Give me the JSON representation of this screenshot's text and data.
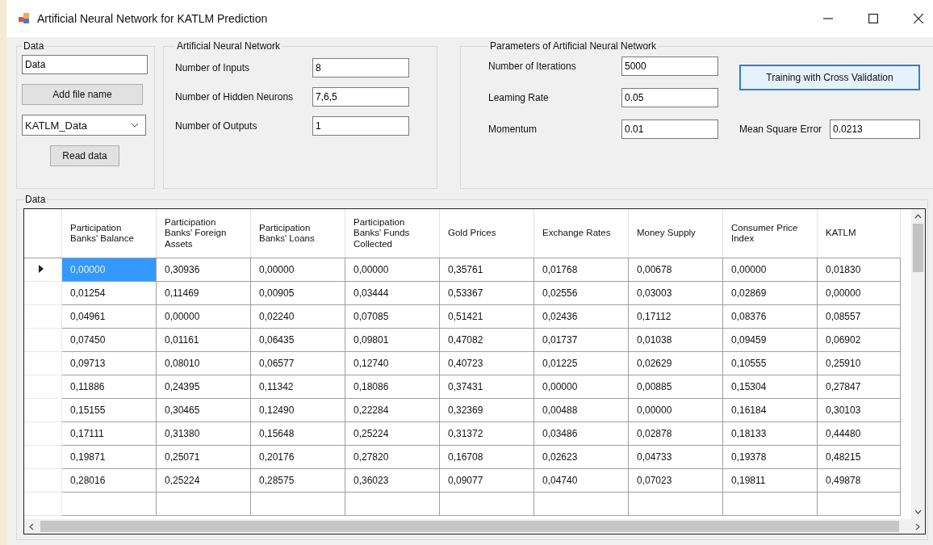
{
  "window": {
    "title": "Artificial Neural Network for KATLM Prediction"
  },
  "data_group": {
    "title": "Data",
    "file_field": {
      "value": "Data"
    },
    "add_button": "Add file name",
    "dataset_select": {
      "value": "KATLM_Data"
    },
    "read_button": "Read data"
  },
  "ann_group": {
    "title": "Artificial Neural Network",
    "fields": [
      {
        "label": "Number of Inputs",
        "value": "8"
      },
      {
        "label": "Number of Hidden Neurons",
        "value": "7,6,5"
      },
      {
        "label": "Number of Outputs",
        "value": "1"
      }
    ]
  },
  "params_group": {
    "title": "Parameters of Artificial Neural Network",
    "fields": [
      {
        "label": "Number of Iterations",
        "value": "5000"
      },
      {
        "label": "Leaming Rate",
        "value": "0.05"
      },
      {
        "label": "Momentum",
        "value": "0.01"
      }
    ],
    "train_button": {
      "label": "Training with Cross Validation",
      "focused": true
    },
    "mse": {
      "label": "Mean Square Error",
      "value": "0.0213"
    }
  },
  "table_group": {
    "title": "Data",
    "columns": [
      "Participation Banks' Balance",
      "Participation Banks' Foreign Assets",
      "Participation Banks' Loans",
      "Participation Banks' Funds Collected",
      "Gold Prices",
      "Exchange Rates",
      "Money Supply",
      "Consumer Price Index",
      "KATLM"
    ],
    "rows": [
      {
        "selected": true,
        "cells": [
          "0,00000",
          "0,30936",
          "0,00000",
          "0,00000",
          "0,35761",
          "0,01768",
          "0,00678",
          "0,00000",
          "0,01830"
        ]
      },
      {
        "selected": false,
        "cells": [
          "0,01254",
          "0,11469",
          "0,00905",
          "0,03444",
          "0,53367",
          "0,02556",
          "0,03003",
          "0,02869",
          "0,00000"
        ]
      },
      {
        "selected": false,
        "cells": [
          "0,04961",
          "0,00000",
          "0,02240",
          "0,07085",
          "0,51421",
          "0,02436",
          "0,17112",
          "0,08376",
          "0,08557"
        ]
      },
      {
        "selected": false,
        "cells": [
          "0,07450",
          "0,01161",
          "0,06435",
          "0,09801",
          "0,47082",
          "0,01737",
          "0,01038",
          "0,09459",
          "0,06902"
        ]
      },
      {
        "selected": false,
        "cells": [
          "0,09713",
          "0,08010",
          "0,06577",
          "0,12740",
          "0,40723",
          "0,01225",
          "0,02629",
          "0,10555",
          "0,25910"
        ]
      },
      {
        "selected": false,
        "cells": [
          "0,11886",
          "0,24395",
          "0,11342",
          "0,18086",
          "0,37431",
          "0,00000",
          "0,00885",
          "0,15304",
          "0,27847"
        ]
      },
      {
        "selected": false,
        "cells": [
          "0,15155",
          "0,30465",
          "0,12490",
          "0,22284",
          "0,32369",
          "0,00488",
          "0,00000",
          "0,16184",
          "0,30103"
        ]
      },
      {
        "selected": false,
        "cells": [
          "0,17111",
          "0,31380",
          "0,15648",
          "0,25224",
          "0,31372",
          "0,03486",
          "0,02878",
          "0,18133",
          "0,44480"
        ]
      },
      {
        "selected": false,
        "cells": [
          "0,19871",
          "0,25071",
          "0,20176",
          "0,27820",
          "0,16708",
          "0,02623",
          "0,04733",
          "0,19378",
          "0,48215"
        ]
      },
      {
        "selected": false,
        "cells": [
          "0,28016",
          "0,25224",
          "0,28575",
          "0,36023",
          "0,09077",
          "0,04740",
          "0,07023",
          "0,19811",
          "0,49878"
        ]
      }
    ]
  }
}
